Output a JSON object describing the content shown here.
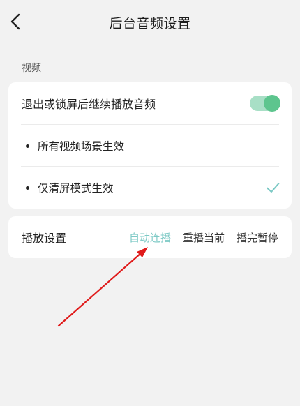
{
  "header": {
    "title": "后台音频设置",
    "back_icon": "chevron-left-icon"
  },
  "section": {
    "label": "视频"
  },
  "background_audio": {
    "label": "退出或锁屏后继续播放音频",
    "toggle_on": true,
    "toggle_color": "#5dc58e",
    "options": [
      {
        "label": "所有视频场景生效",
        "selected": false
      },
      {
        "label": "仅清屏模式生效",
        "selected": true
      }
    ]
  },
  "playback": {
    "label": "播放设置",
    "options": [
      {
        "label": "自动连播",
        "selected": true
      },
      {
        "label": "重播当前",
        "selected": false
      },
      {
        "label": "播完暂停",
        "selected": false
      }
    ],
    "selected_color": "#7cc9c5"
  },
  "annotation": {
    "color": "#e01b1b",
    "icon": "red-arrow"
  }
}
